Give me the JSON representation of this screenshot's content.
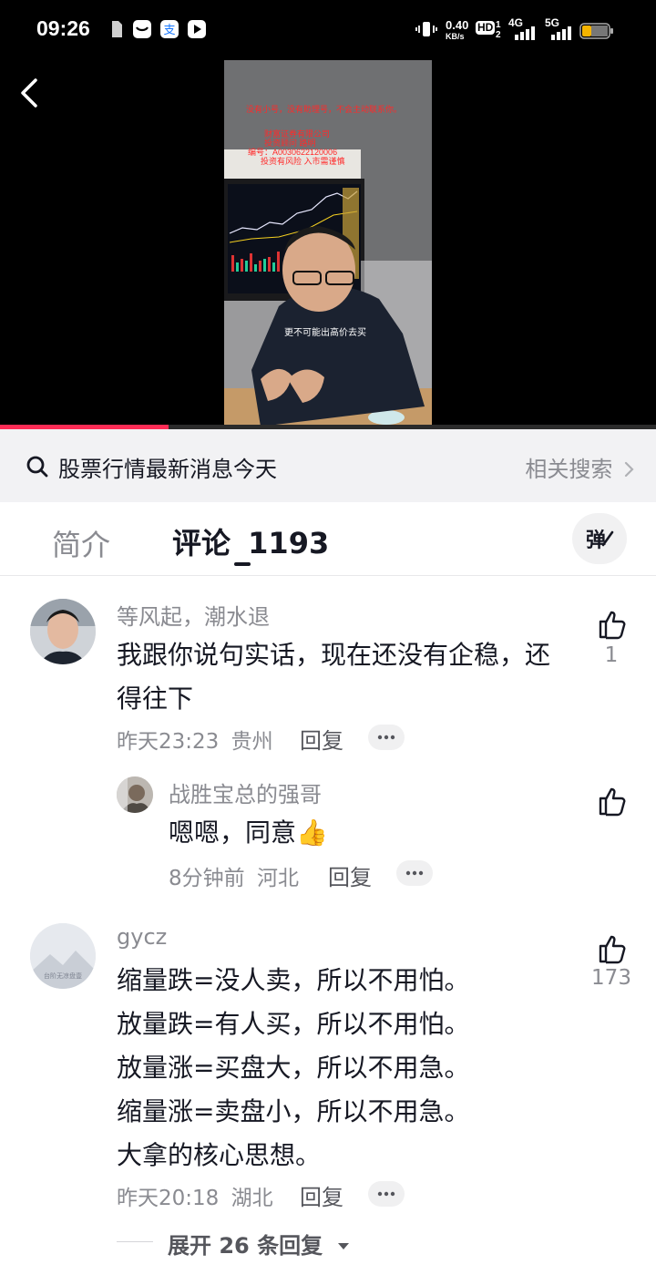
{
  "status_bar": {
    "time": "09:26",
    "network_speed_top": "0.40",
    "network_speed_unit": "KB/s",
    "hd_label": "HD",
    "hd_sub_top": "1",
    "hd_sub_bottom": "2",
    "net_4g": "4G",
    "net_5g": "5G"
  },
  "video": {
    "overlay_line1": "没有小号，没有助理号，不会主动联系你。",
    "overlay_line2": "财富证券有限公司",
    "overlay_line3": "投资顾问 路明",
    "overlay_line4": "编号：A0030622120006",
    "overlay_line5": "投资有风险 入市需谨慎",
    "subtitle": "更不可能出高价去买",
    "progress": 0.257
  },
  "search_strip": {
    "query": "股票行情最新消息今天",
    "related_label": "相关搜索"
  },
  "tabs": {
    "intro_label": "简介",
    "comments_label": "评论",
    "comments_count": "1193"
  },
  "comments": [
    {
      "username": "等风起，潮水退",
      "text_lines": [
        "我跟你说句实话，现在还没有企稳，还",
        "得往下"
      ],
      "time": "昨天23:23",
      "location": "贵州",
      "reply_label": "回复",
      "likes": "1"
    },
    {
      "username": "战胜宝总的强哥",
      "text": "嗯嗯，同意👍",
      "time": "8分钟前",
      "location": "河北",
      "reply_label": "回复",
      "likes": ""
    },
    {
      "username": "gycz",
      "avatar_caption": "台阶无凉盘壹",
      "text_lines": [
        "缩量跌=没人卖，所以不用怕。",
        "放量跌=有人买，所以不用怕。",
        "放量涨=买盘大，所以不用急。",
        "缩量涨=卖盘小，所以不用急。",
        "大拿的核心思想。"
      ],
      "time": "昨天20:18",
      "location": "湖北",
      "reply_label": "回复",
      "likes": "173"
    }
  ],
  "expand_replies": "展开 26 条回复",
  "colors": {
    "accent": "#fe2c55",
    "text_primary": "#161823",
    "text_secondary": "#8a8b91"
  },
  "icons": [
    "back-arrow-icon",
    "search-icon",
    "chevron-right-icon",
    "danmaku-icon",
    "thumbs-up-icon",
    "more-dots-icon",
    "caret-down-icon"
  ]
}
